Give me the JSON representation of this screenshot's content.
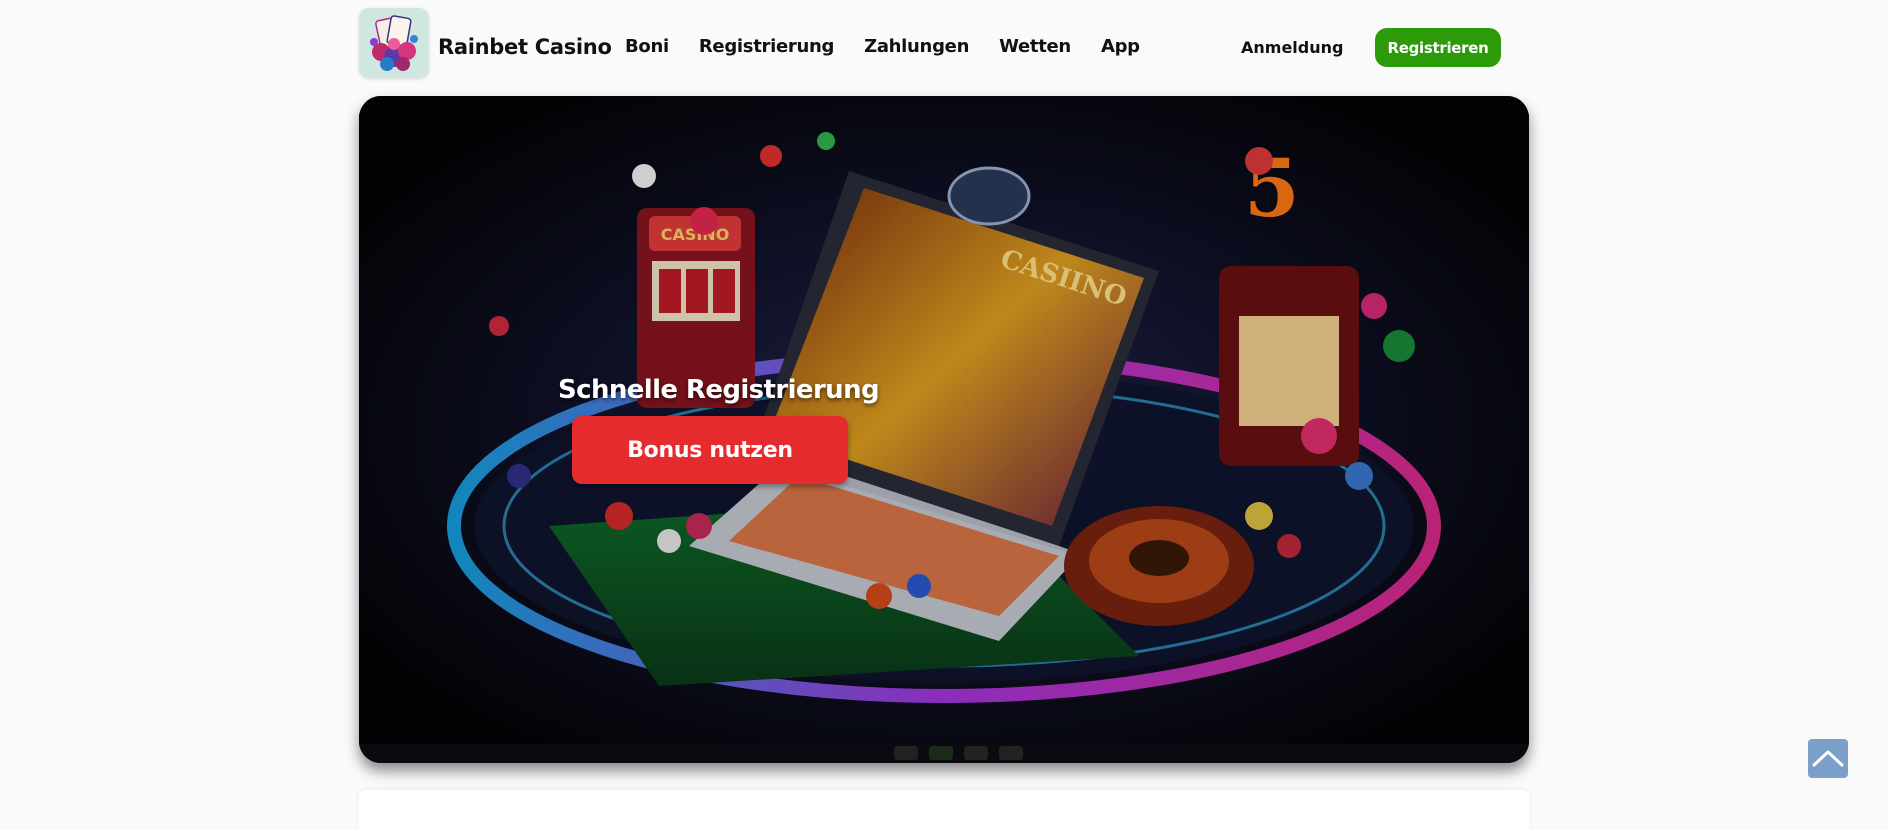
{
  "header": {
    "brand": "Rainbet Casino",
    "logo_icon": "casino-logo-icon",
    "nav": [
      "Boni",
      "Registrierung",
      "Zahlungen",
      "Wetten",
      "App"
    ],
    "login_label": "Anmeldung",
    "register_label": "Registrieren"
  },
  "hero": {
    "title": "Schnelle Registrierung",
    "button_label": "Bonus nutzen",
    "image": "casino-neon-illustration",
    "slide_dots": 4
  },
  "next_section": {
    "heading": ""
  },
  "scroll_top_icon": "chevron-up-icon",
  "colors": {
    "register_button": "#2d9a09",
    "hero_button": "#e62b2e",
    "scroll_top": "#7b9fc9",
    "background": "#fafafa"
  }
}
